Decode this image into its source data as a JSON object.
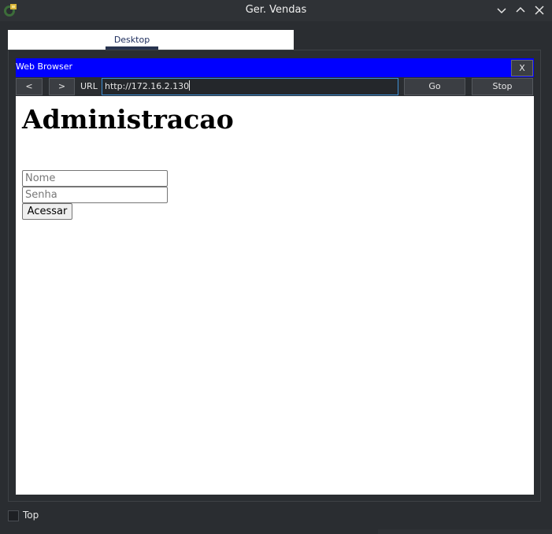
{
  "window": {
    "title": "Ger. Vendas"
  },
  "tabs": [
    {
      "label": "Desktop"
    }
  ],
  "browser": {
    "title": "Web Browser",
    "close_label": "X",
    "back_label": "<",
    "forward_label": ">",
    "url_label": "URL",
    "url_value": "http://172.16.2.130",
    "go_label": "Go",
    "stop_label": "Stop"
  },
  "page": {
    "heading": "Administracao",
    "name_placeholder": "Nome",
    "password_placeholder": "Senha",
    "submit_label": "Acessar"
  },
  "footer": {
    "top_label": "Top",
    "top_checked": false
  },
  "colors": {
    "browser_titlebar": "#0000ff",
    "url_focus_border": "#3d8fd6"
  },
  "icons": [
    "app-logo-icon",
    "minimize-icon",
    "maximize-icon",
    "close-icon"
  ]
}
